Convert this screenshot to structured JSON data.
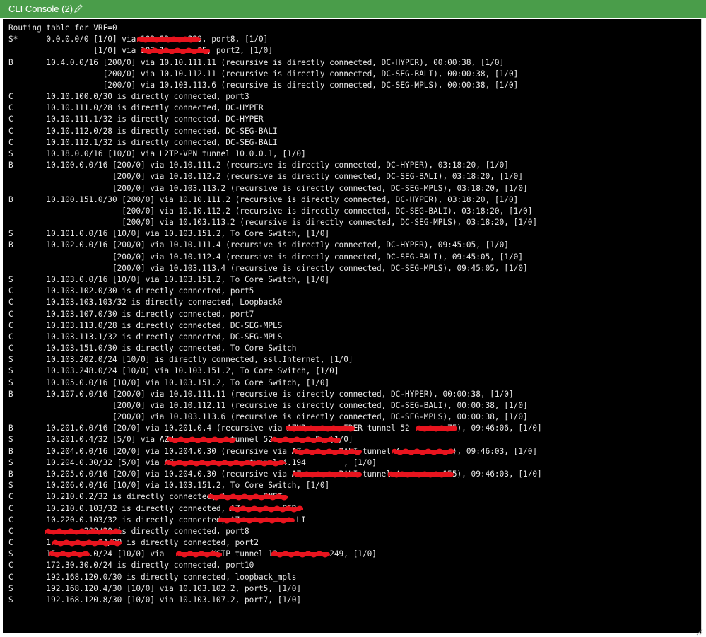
{
  "window": {
    "title": "CLI Console (2)",
    "edit_icon": "pencil-icon",
    "colors": {
      "titlebar": "#4a9d4a",
      "console_bg": "#000000",
      "console_text": "#e8e8e8",
      "redaction": "#e8141e"
    }
  },
  "console": {
    "lines": [
      "Routing table for VRF=0",
      "S*      0.0.0.0/0 [1/0] via 103.13    229, port8, [1/0]",
      "                  [1/0] via 103.1       05, port2, [1/0]",
      "B       10.4.0.0/16 [200/0] via 10.10.111.11 (recursive is directly connected, DC-HYPER), 00:00:38, [1/0]",
      "                    [200/0] via 10.10.112.11 (recursive is directly connected, DC-SEG-BALI), 00:00:38, [1/0]",
      "                    [200/0] via 10.103.113.6 (recursive is directly connected, DC-SEG-MPLS), 00:00:38, [1/0]",
      "C       10.10.100.0/30 is directly connected, port3",
      "C       10.10.111.0/28 is directly connected, DC-HYPER",
      "C       10.10.111.1/32 is directly connected, DC-HYPER",
      "C       10.10.112.0/28 is directly connected, DC-SEG-BALI",
      "C       10.10.112.1/32 is directly connected, DC-SEG-BALI",
      "S       10.18.0.0/16 [10/0] via L2TP-VPN tunnel 10.0.0.1, [1/0]",
      "B       10.100.0.0/16 [200/0] via 10.10.111.2 (recursive is directly connected, DC-HYPER), 03:18:20, [1/0]",
      "                      [200/0] via 10.10.112.2 (recursive is directly connected, DC-SEG-BALI), 03:18:20, [1/0]",
      "                      [200/0] via 10.103.113.2 (recursive is directly connected, DC-SEG-MPLS), 03:18:20, [1/0]",
      "B       10.100.151.0/30 [200/0] via 10.10.111.2 (recursive is directly connected, DC-HYPER), 03:18:20, [1/0]",
      "                        [200/0] via 10.10.112.2 (recursive is directly connected, DC-SEG-BALI), 03:18:20, [1/0]",
      "                        [200/0] via 10.103.113.2 (recursive is directly connected, DC-SEG-MPLS), 03:18:20, [1/0]",
      "S       10.101.0.0/16 [10/0] via 10.103.151.2, To Core Switch, [1/0]",
      "B       10.102.0.0/16 [200/0] via 10.10.111.4 (recursive is directly connected, DC-HYPER), 09:45:05, [1/0]",
      "                      [200/0] via 10.10.112.4 (recursive is directly connected, DC-SEG-BALI), 09:45:05, [1/0]",
      "                      [200/0] via 10.103.113.4 (recursive is directly connected, DC-SEG-MPLS), 09:45:05, [1/0]",
      "S       10.103.0.0/16 [10/0] via 10.103.151.2, To Core Switch, [1/0]",
      "C       10.103.102.0/30 is directly connected, port5",
      "C       10.103.103.103/32 is directly connected, Loopback0",
      "C       10.103.107.0/30 is directly connected, port7",
      "C       10.103.113.0/28 is directly connected, DC-SEG-MPLS",
      "C       10.103.113.1/32 is directly connected, DC-SEG-MPLS",
      "C       10.103.151.0/30 is directly connected, To Core Switch",
      "S       10.103.202.0/24 [10/0] is directly connected, ssl.Internet, [1/0]",
      "S       10.103.248.0/24 [10/0] via 10.103.151.2, To Core Switch, [1/0]",
      "S       10.105.0.0/16 [10/0] via 10.103.151.2, To Core Switch, [1/0]",
      "B       10.107.0.0/16 [200/0] via 10.10.111.11 (recursive is directly connected, DC-HYPER), 00:00:38, [1/0]",
      "                      [200/0] via 10.10.112.11 (recursive is directly connected, DC-SEG-BALI), 00:00:38, [1/0]",
      "                      [200/0] via 10.103.113.6 (recursive is directly connected, DC-SEG-MPLS), 00:00:38, [1/0]",
      "B       10.201.0.0/16 [20/0] via 10.201.0.4 (recursive via AZUR        IDER tunnel 52        75), 09:46:06, [1/0]",
      "S       10.201.0.4/32 [5/0] via AZU            tunnel 52.        5, [1/0]",
      "B       10.204.0.0/16 [20/0] via 10.204.0.30 (recursive via AZ        BALI tunnel 4.          ), 09:46:03, [1/0]",
      "S       10.204.0.30/32 [5/0] via AZ                tunnel 4.194        , [1/0]",
      "B       10.205.0.0/16 [20/0] via 10.204.0.30 (recursive via AZ        BALI tunnel 4.        155), 09:46:03, [1/0]",
      "S       10.206.0.0/16 [10/0] via 10.103.151.2, To Core Switch, [1/0]",
      "C       10.210.0.2/32 is directly connected, A        RNET",
      "C       10.210.0.103/32 is directly connected, AZ         PER",
      "C       10.220.0.103/32 is directly connected, A7            LI",
      "C               208/30 is directly connected, port8",
      "C       1          04/29 is directly connected, port2",
      "S       15       .0/24 [10/0] via          KSTP tunnel 13           249, [1/0]",
      "C       172.30.30.0/24 is directly connected, port10",
      "C       192.168.120.0/30 is directly connected, loopback_mpls",
      "S       192.168.120.4/30 [10/0] via 10.103.102.2, port5, [1/0]",
      "S       192.168.120.8/30 [10/0] via 10.103.107.2, port7, [1/0]"
    ]
  }
}
